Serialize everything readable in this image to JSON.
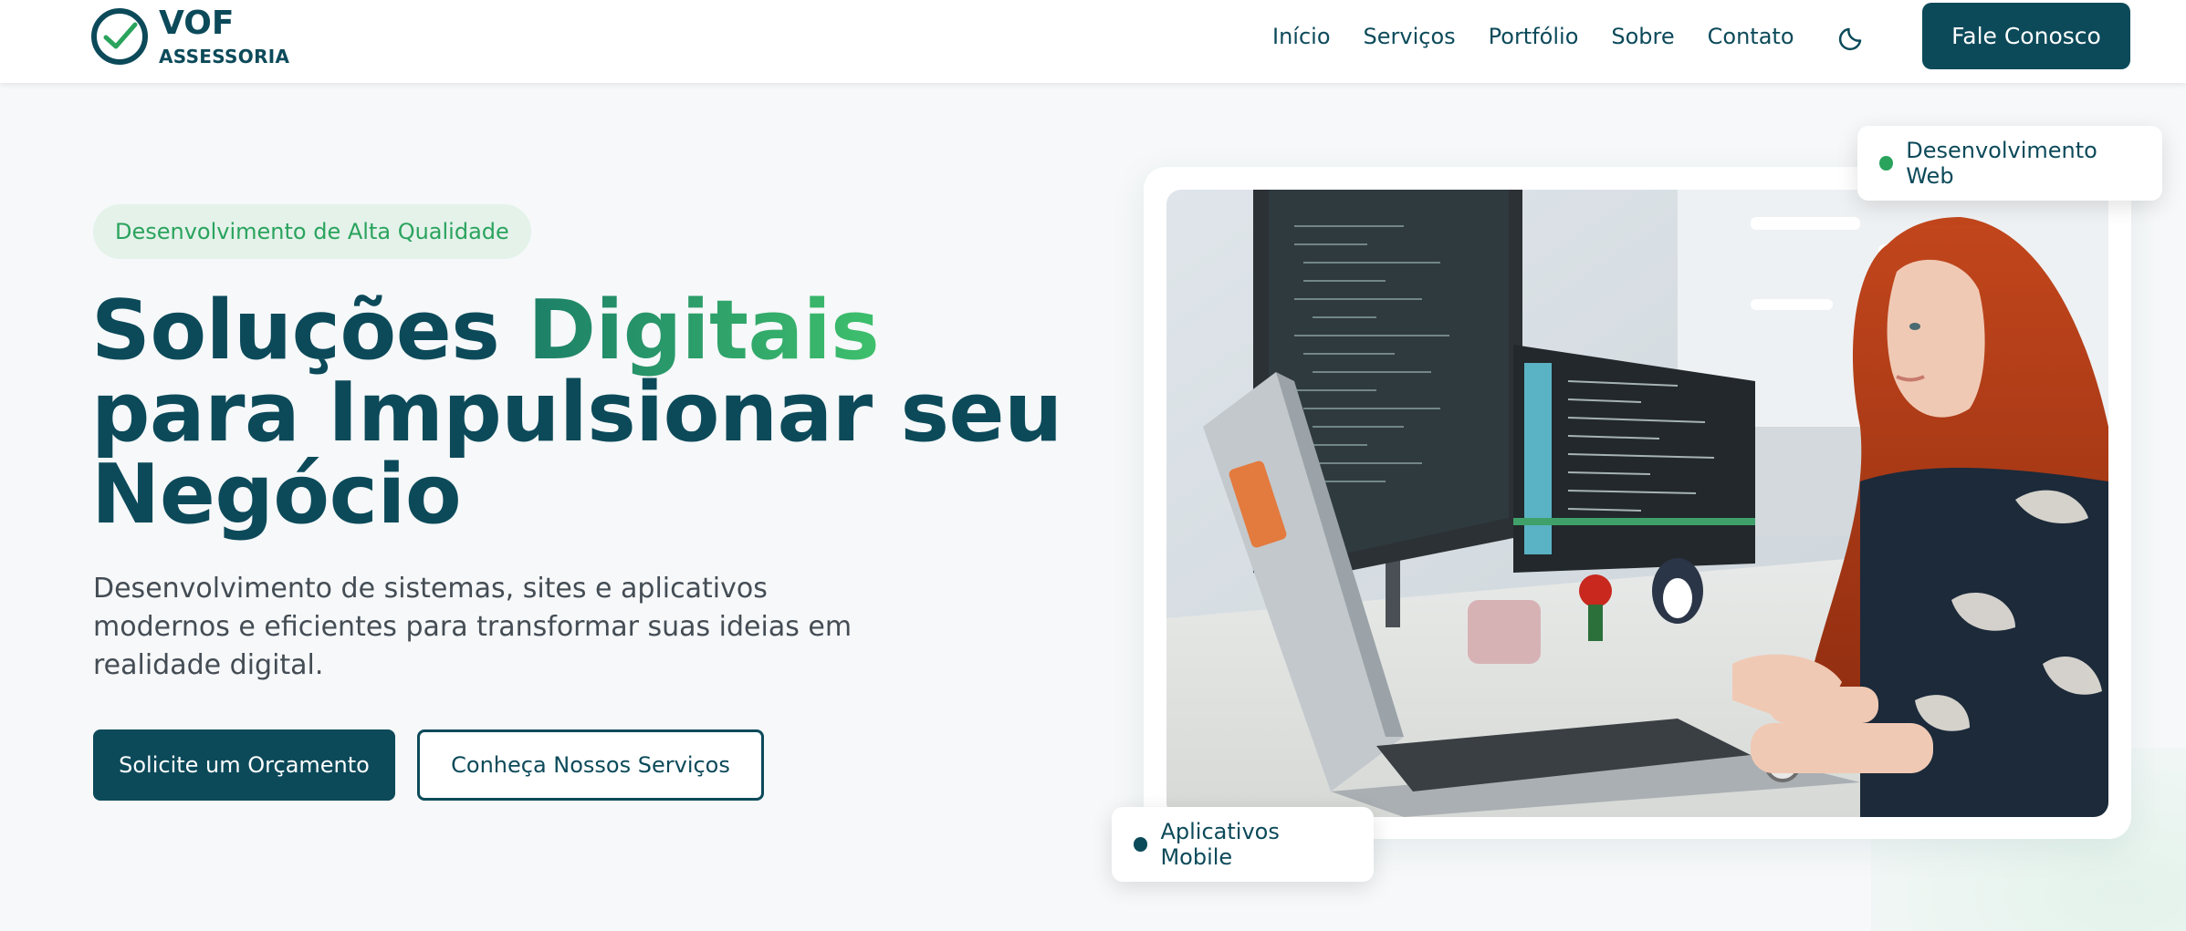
{
  "brand": {
    "name": "VOF",
    "subtitle": "ASSESSORIA"
  },
  "nav": {
    "links": [
      "Início",
      "Serviços",
      "Portfólio",
      "Sobre",
      "Contato"
    ],
    "theme_icon": "moon-icon",
    "cta_label": "Fale Conosco"
  },
  "hero": {
    "badge": "Desenvolvimento de Alta Qualidade",
    "title_part1": "Soluções ",
    "title_accent": "Digitais",
    "title_part2": " para Impulsionar seu Negócio",
    "subtitle": "Desenvolvimento de sistemas, sites e aplicativos modernos e eficientes para transformar suas ideias em realidade digital.",
    "primary_button": "Solicite um Orçamento",
    "secondary_button": "Conheça Nossos Serviços"
  },
  "tags": {
    "web": "Desenvolvimento Web",
    "mobile": "Aplicativos Mobile"
  },
  "colors": {
    "primary": "#0c4a5a",
    "accent_green": "#3ec06c",
    "badge_bg": "#e4f2ea",
    "page_bg": "#f6f8f9"
  }
}
